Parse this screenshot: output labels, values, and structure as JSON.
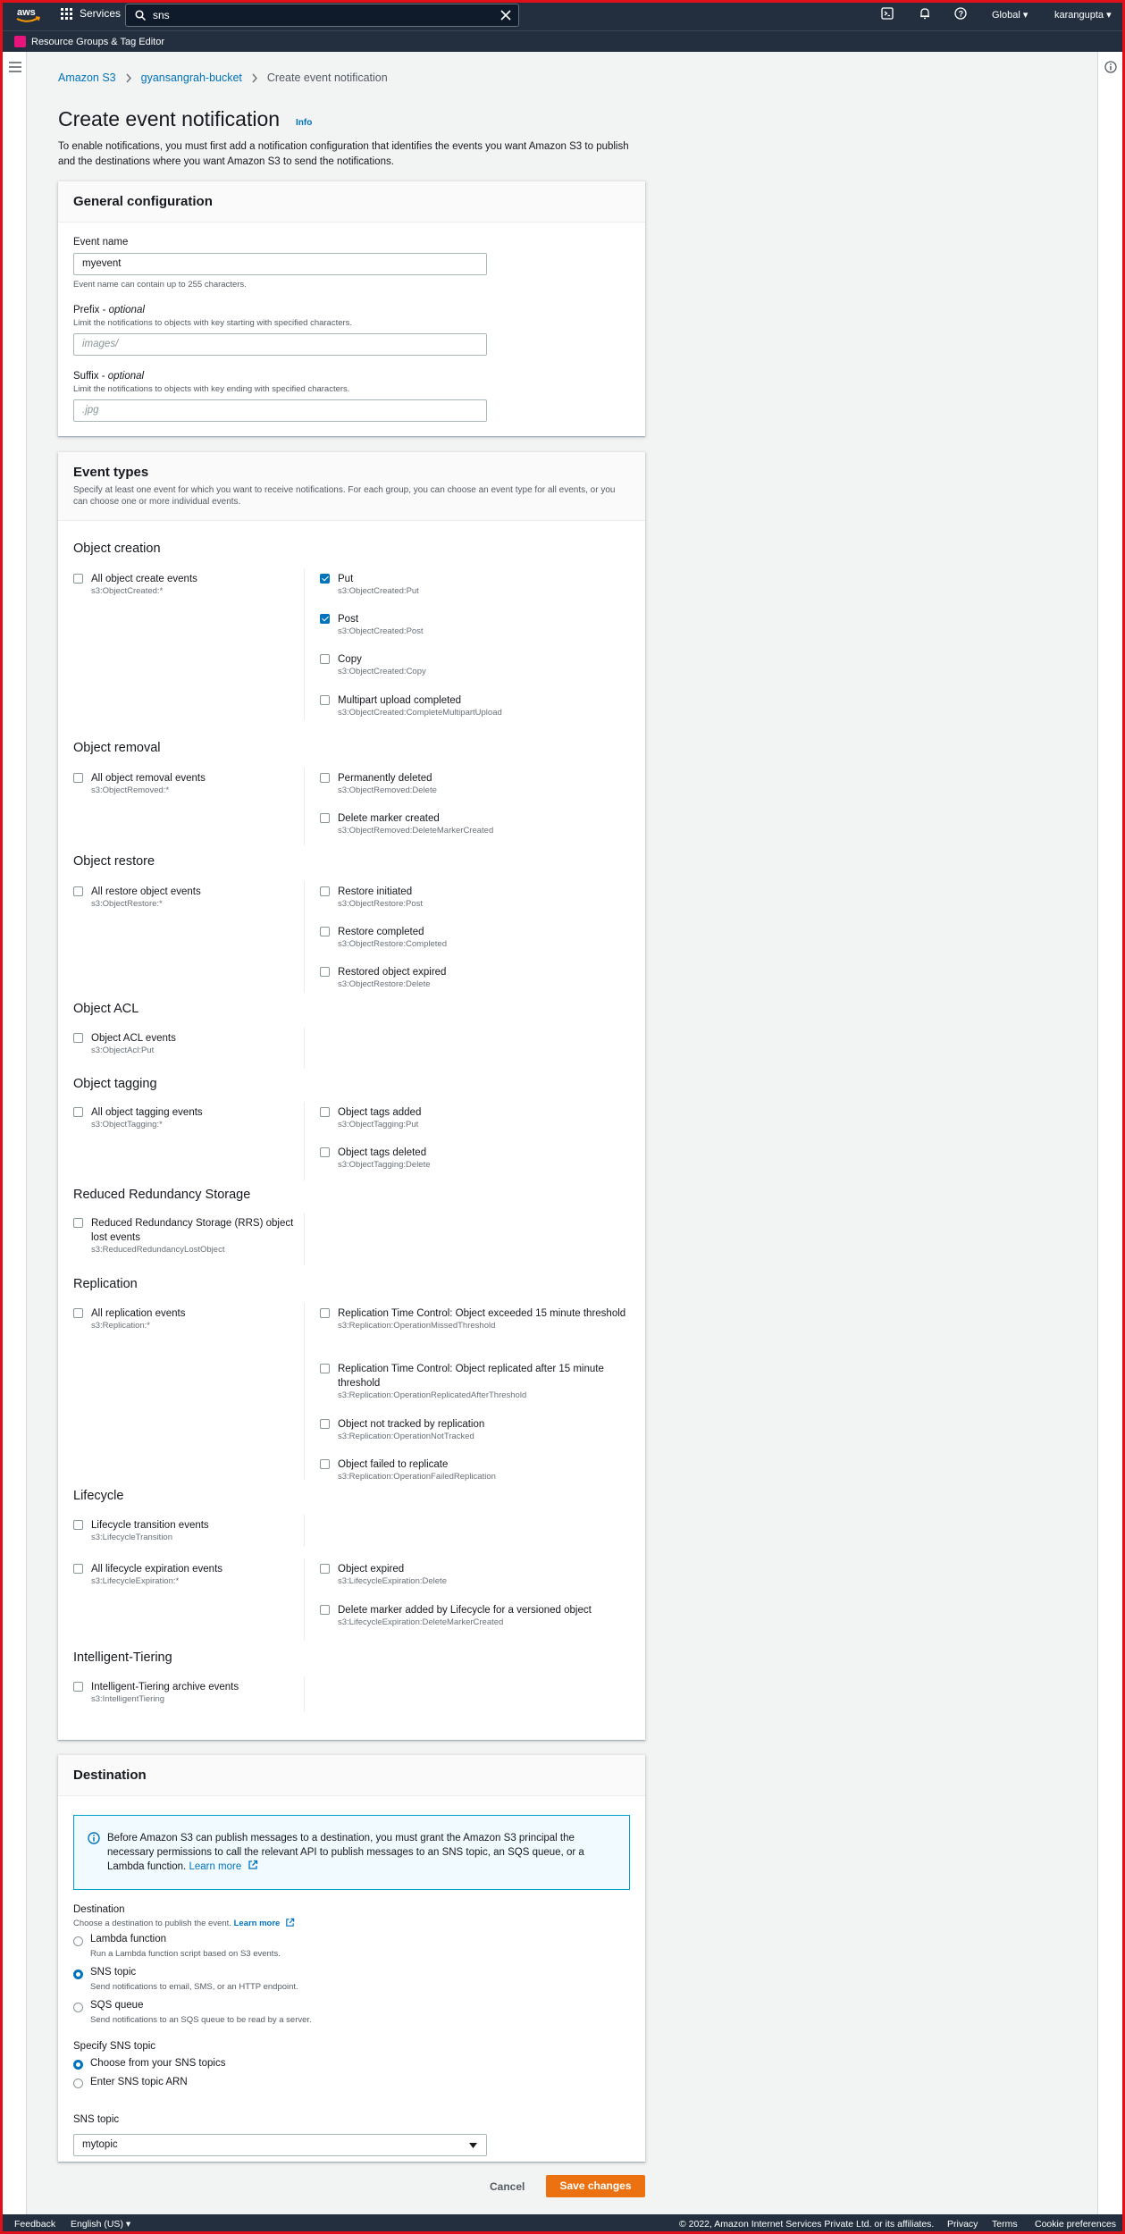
{
  "topnav": {
    "services_label": "Services",
    "search_value": "sns",
    "region": "Global ▾",
    "user": "karangupta ▾"
  },
  "subnav": {
    "label": "Resource Groups & Tag Editor"
  },
  "breadcrumb": {
    "items": [
      "Amazon S3",
      "gyansangrah-bucket",
      "Create event notification"
    ]
  },
  "page": {
    "title": "Create event notification",
    "info": "Info",
    "intro": "To enable notifications, you must first add a notification configuration that identifies the events you want Amazon S3 to publish and the destinations where you want Amazon S3 to send the notifications."
  },
  "general": {
    "title": "General configuration",
    "event_name_label": "Event name",
    "event_name_value": "myevent",
    "event_name_hint": "Event name can contain up to 255 characters.",
    "prefix_label": "Prefix - ",
    "prefix_opt": "optional",
    "prefix_desc": "Limit the notifications to objects with key starting with specified characters.",
    "prefix_placeholder": "images/",
    "suffix_label": "Suffix - ",
    "suffix_opt": "optional",
    "suffix_desc": "Limit the notifications to objects with key ending with specified characters.",
    "suffix_placeholder": ".jpg"
  },
  "event_types": {
    "title": "Event types",
    "desc": "Specify at least one event for which you want to receive notifications. For each group, you can choose an event type for all events, or you can choose one or more individual events.",
    "groups": [
      {
        "name": "Object creation",
        "left": [
          {
            "label": "All object create events",
            "code": "s3:ObjectCreated:*",
            "checked": false
          }
        ],
        "right": [
          {
            "label": "Put",
            "code": "s3:ObjectCreated:Put",
            "checked": true
          },
          {
            "label": "Post",
            "code": "s3:ObjectCreated:Post",
            "checked": true
          },
          {
            "label": "Copy",
            "code": "s3:ObjectCreated:Copy",
            "checked": false
          },
          {
            "label": "Multipart upload completed",
            "code": "s3:ObjectCreated:CompleteMultipartUpload",
            "checked": false
          }
        ]
      },
      {
        "name": "Object removal",
        "left": [
          {
            "label": "All object removal events",
            "code": "s3:ObjectRemoved:*",
            "checked": false
          }
        ],
        "right": [
          {
            "label": "Permanently deleted",
            "code": "s3:ObjectRemoved:Delete",
            "checked": false
          },
          {
            "label": "Delete marker created",
            "code": "s3:ObjectRemoved:DeleteMarkerCreated",
            "checked": false
          }
        ]
      },
      {
        "name": "Object restore",
        "left": [
          {
            "label": "All restore object events",
            "code": "s3:ObjectRestore:*",
            "checked": false
          }
        ],
        "right": [
          {
            "label": "Restore initiated",
            "code": "s3:ObjectRestore:Post",
            "checked": false
          },
          {
            "label": "Restore completed",
            "code": "s3:ObjectRestore:Completed",
            "checked": false
          },
          {
            "label": "Restored object expired",
            "code": "s3:ObjectRestore:Delete",
            "checked": false
          }
        ]
      },
      {
        "name": "Object ACL",
        "left": [
          {
            "label": "Object ACL events",
            "code": "s3:ObjectAcl:Put",
            "checked": false
          }
        ],
        "right": []
      },
      {
        "name": "Object tagging",
        "left": [
          {
            "label": "All object tagging events",
            "code": "s3:ObjectTagging:*",
            "checked": false
          }
        ],
        "right": [
          {
            "label": "Object tags added",
            "code": "s3:ObjectTagging:Put",
            "checked": false
          },
          {
            "label": "Object tags deleted",
            "code": "s3:ObjectTagging:Delete",
            "checked": false
          }
        ]
      },
      {
        "name": "Reduced Redundancy Storage",
        "left": [
          {
            "label": "Reduced Redundancy Storage (RRS) object lost events",
            "code": "s3:ReducedRedundancyLostObject",
            "checked": false
          }
        ],
        "right": []
      },
      {
        "name": "Replication",
        "left": [
          {
            "label": "All replication events",
            "code": "s3:Replication:*",
            "checked": false
          }
        ],
        "right": [
          {
            "label": "Replication Time Control: Object exceeded 15 minute threshold",
            "code": "s3:Replication:OperationMissedThreshold",
            "checked": false
          },
          {
            "label": "Replication Time Control: Object replicated after 15 minute threshold",
            "code": "s3:Replication:OperationReplicatedAfterThreshold",
            "checked": false
          },
          {
            "label": "Object not tracked by replication",
            "code": "s3:Replication:OperationNotTracked",
            "checked": false
          },
          {
            "label": "Object failed to replicate",
            "code": "s3:Replication:OperationFailedReplication",
            "checked": false
          }
        ]
      },
      {
        "name": "Lifecycle",
        "left": [
          {
            "label": "Lifecycle transition events",
            "code": "s3:LifecycleTransition",
            "checked": false
          },
          {
            "label": "All lifecycle expiration events",
            "code": "s3:LifecycleExpiration:*",
            "checked": false
          }
        ],
        "right": [
          {
            "label": "Object expired",
            "code": "s3:LifecycleExpiration:Delete",
            "checked": false
          },
          {
            "label": "Delete marker added by Lifecycle for a versioned object",
            "code": "s3:LifecycleExpiration:DeleteMarkerCreated",
            "checked": false
          }
        ]
      },
      {
        "name": "Intelligent-Tiering",
        "left": [
          {
            "label": "Intelligent-Tiering archive events",
            "code": "s3:IntelligentTiering",
            "checked": false
          }
        ],
        "right": []
      }
    ]
  },
  "destination": {
    "title": "Destination",
    "alert_text": "Before Amazon S3 can publish messages to a destination, you must grant the Amazon S3 principal the necessary permissions to call the relevant API to publish messages to an SNS topic, an SQS queue, or a Lambda function.",
    "alert_link": "Learn more",
    "dest_label": "Destination",
    "dest_desc": "Choose a destination to publish the event.",
    "dest_link": "Learn more",
    "options": [
      {
        "label": "Lambda function",
        "desc": "Run a Lambda function script based on S3 events.",
        "selected": false
      },
      {
        "label": "SNS topic",
        "desc": "Send notifications to email, SMS, or an HTTP endpoint.",
        "selected": true
      },
      {
        "label": "SQS queue",
        "desc": "Send notifications to an SQS queue to be read by a server.",
        "selected": false
      }
    ],
    "specify_label": "Specify SNS topic",
    "specify_options": [
      {
        "label": "Choose from your SNS topics",
        "selected": true
      },
      {
        "label": "Enter SNS topic ARN",
        "selected": false
      }
    ],
    "topic_label": "SNS topic",
    "topic_value": "mytopic"
  },
  "actions": {
    "cancel": "Cancel",
    "save": "Save changes"
  },
  "footer": {
    "feedback": "Feedback",
    "language": "English (US) ▾",
    "copyright": "© 2022, Amazon Internet Services Private Ltd. or its affiliates.",
    "privacy": "Privacy",
    "terms": "Terms",
    "cookies": "Cookie preferences"
  }
}
